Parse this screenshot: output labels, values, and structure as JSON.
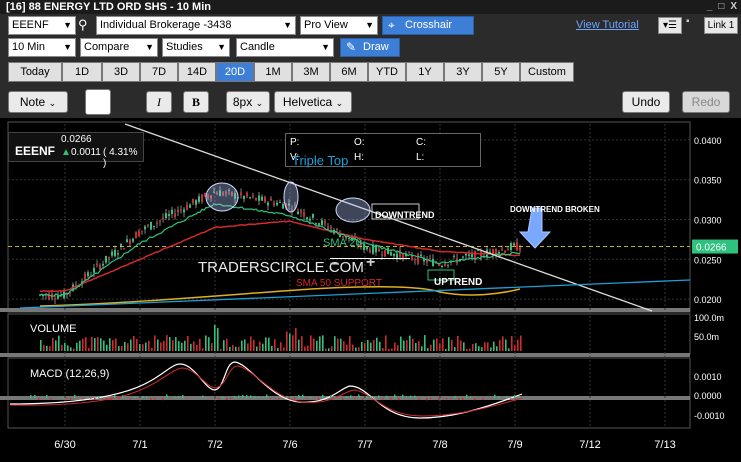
{
  "window": {
    "title": "[16] 88 ENERGY LTD ORD SHS - 10 Min",
    "controls": [
      "_",
      "□",
      "X"
    ]
  },
  "toolbar": {
    "symbol": "EEENF",
    "account": "Individual Brokerage -3438",
    "view": "Pro View",
    "crosshair_label": "Crosshair",
    "tutorial_link": "View Tutorial",
    "link_label": "Link 1",
    "interval": "10 Min",
    "compare": "Compare",
    "studies": "Studies",
    "chart_type": "Candle",
    "draw_label": "Draw"
  },
  "range_tabs": [
    "Today",
    "1D",
    "3D",
    "7D",
    "14D",
    "20D",
    "1M",
    "3M",
    "6M",
    "YTD",
    "1Y",
    "3Y",
    "5Y",
    "Custom"
  ],
  "active_range": "20D",
  "drawbar": {
    "note": "Note",
    "italic": "I",
    "bold": "B",
    "font_size": "8px",
    "font": "Helvetica",
    "undo": "Undo",
    "redo": "Redo"
  },
  "quote": {
    "symbol": "EEENF",
    "price": "0.0266",
    "change": "0.0011",
    "change_pct": "( 4.31% )"
  },
  "ohlc": {
    "p": "P:",
    "v": "V:",
    "o": "O:",
    "h": "H:",
    "c": "C:",
    "l": "L:"
  },
  "annotations": {
    "triple_top": "Triple Top",
    "downtrend": "DOWNTREND",
    "downtrend_broken": "DOWNTREND BROKEN",
    "sma20": "SMA 20",
    "sma50": "SMA 50 SUPPORT",
    "uptrend": "UPTREND",
    "watermark": "TRADERSCIRCLE.COM"
  },
  "panels": {
    "volume": "VOLUME",
    "macd": "MACD (12,26,9)"
  },
  "axis": {
    "price_ticks": [
      "0.0400",
      "0.0350",
      "0.0300",
      "0.0250",
      "0.0200"
    ],
    "current_price": "0.0266",
    "volume_ticks": [
      "100.0m",
      "50.0m"
    ],
    "macd_ticks": [
      "0.0010",
      "0.0000",
      "-0.0010"
    ],
    "date_ticks": [
      "6/30",
      "7/1",
      "7/2",
      "7/6",
      "7/7",
      "7/8",
      "7/9",
      "7/12",
      "7/13"
    ]
  },
  "colors": {
    "accent": "#3d7fd6",
    "sma20": "#2ec27e",
    "sma50": "#d12a2a",
    "sma200": "#e0b020",
    "trend": "#1aa0d8",
    "up": "#2ec27e",
    "down": "#d12a2a"
  },
  "chart_data": {
    "type": "line",
    "x": [
      "6/30",
      "7/1",
      "7/2",
      "7/6",
      "7/7",
      "7/8",
      "7/9"
    ],
    "series": [
      {
        "values": [
          0.0205,
          0.0285,
          0.0335,
          0.0318,
          0.0265,
          0.0245,
          0.0266
        ]
      },
      {
        "name": "SMA 20",
        "values": [
          0.0205,
          0.027,
          0.032,
          0.0305,
          0.027,
          0.0245,
          0.0258
        ]
      },
      {
        "name": "SMA 50 SUPPORT",
        "values": [
          0.021,
          0.025,
          0.029,
          0.0298,
          0.0275,
          0.026,
          0.0255
        ]
      }
    ],
    "ylim": [
      0.0185,
      0.042
    ]
  }
}
